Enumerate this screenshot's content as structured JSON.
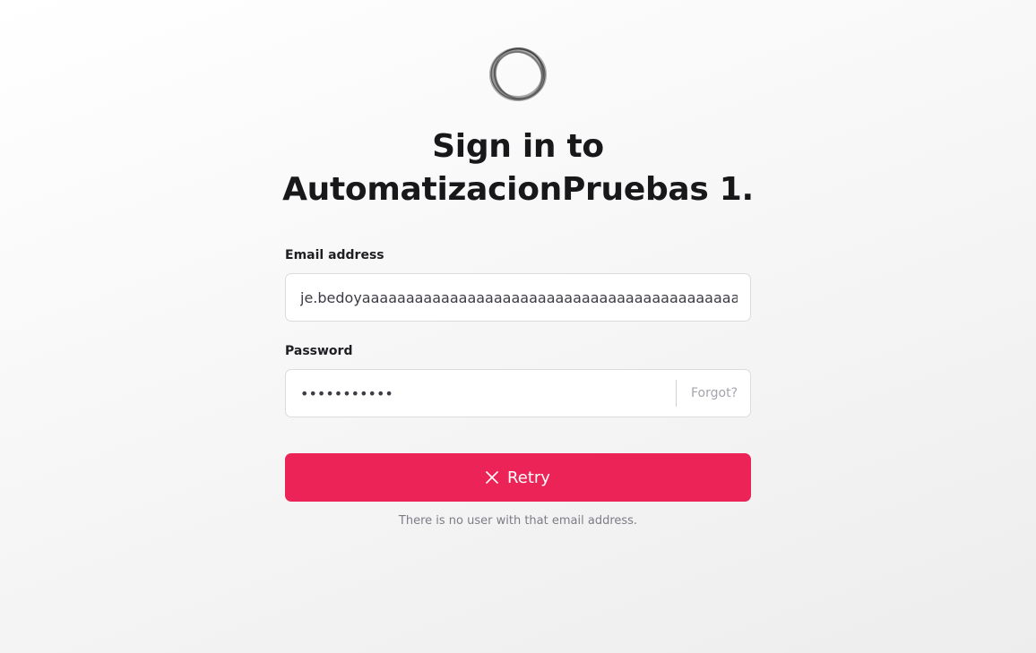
{
  "logo": {
    "icon": "ring-logo-icon"
  },
  "title": {
    "line1": "Sign in to",
    "line2": "AutomatizacionPruebas 1."
  },
  "email": {
    "label": "Email address",
    "value": "je.bedoyaaaaaaaaaaaaaaaaaaaaaaaaaaaaaaaaaaaaaaaaaaaaaa"
  },
  "password": {
    "label": "Password",
    "value": "•••••••••••",
    "forgot_label": "Forgot?"
  },
  "submit": {
    "label": "Retry",
    "icon": "close-icon",
    "color": "#eb2356"
  },
  "error": {
    "message": "There is no user with that email address."
  }
}
